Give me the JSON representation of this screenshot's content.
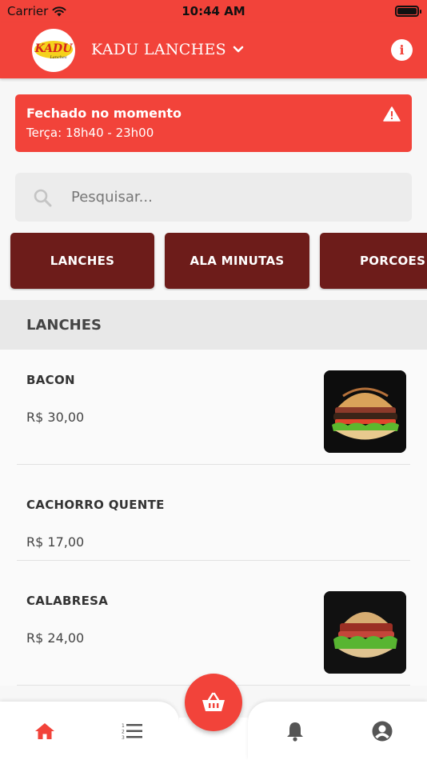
{
  "status_bar": {
    "carrier": "Carrier",
    "time": "10:44 AM"
  },
  "header": {
    "logo_text": "KADU",
    "logo_subtext": "Lanches",
    "restaurant_name": "KADU LANCHES"
  },
  "banner": {
    "title": "Fechado no momento",
    "hours": "Terça: 18h40 - 23h00"
  },
  "search": {
    "placeholder": "Pesquisar..."
  },
  "categories": [
    "LANCHES",
    "ALA MINUTAS",
    "PORCOES"
  ],
  "section": {
    "title": "LANCHES"
  },
  "products": [
    {
      "name": "BACON",
      "price": "R$ 30,00",
      "has_image": true
    },
    {
      "name": "CACHORRO QUENTE",
      "price": "R$ 17,00",
      "has_image": false
    },
    {
      "name": "CALABRESA",
      "price": "R$ 24,00",
      "has_image": true
    }
  ],
  "colors": {
    "primary": "#f2433a",
    "category_bg": "#6d1c1a",
    "nav_active": "#f2433a",
    "nav_inactive": "#555555"
  },
  "icons": {
    "status": [
      "wifi-icon",
      "battery-icon"
    ],
    "header": [
      "chevron-down-icon",
      "info-icon"
    ],
    "banner": "warning-icon",
    "search": "search-icon",
    "nav": [
      "home-icon",
      "ordered-list-icon",
      "basket-icon",
      "bell-icon",
      "user-icon"
    ]
  }
}
